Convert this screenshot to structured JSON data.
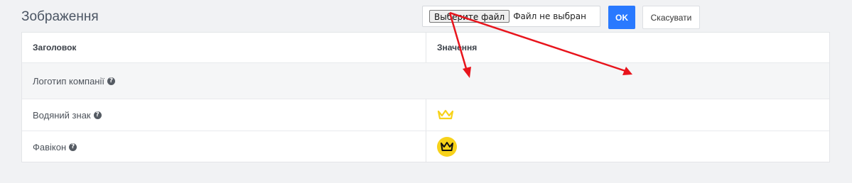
{
  "section": {
    "title": "Зображення"
  },
  "table": {
    "headers": {
      "title": "Заголовок",
      "value": "Значення"
    },
    "rows": [
      {
        "label": "Логотип компанії",
        "help_icon": "question-circle-icon"
      },
      {
        "label": "Водяний знак",
        "help_icon": "question-circle-icon",
        "value_icon": "crown-icon"
      },
      {
        "label": "Фавікон",
        "help_icon": "question-circle-icon",
        "value_icon": "crown-badge-icon"
      }
    ]
  },
  "upload": {
    "choose_label": "Выберите файл",
    "status": "Файл не выбран",
    "ok_label": "OK",
    "cancel_label": "Скасувати"
  },
  "colors": {
    "accent": "#2979ff",
    "annotation_arrow": "#e8141c",
    "crown_yellow": "#f7d21a"
  }
}
